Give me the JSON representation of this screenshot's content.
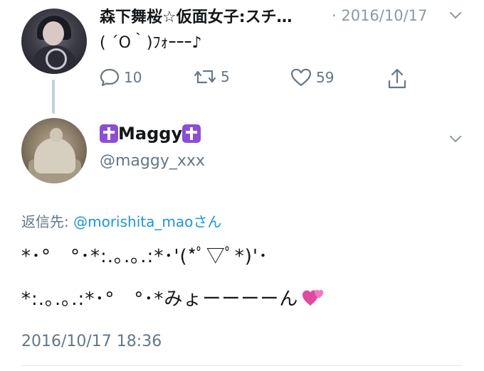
{
  "parent_tweet": {
    "name": "森下舞桜☆仮面女子:スチ…",
    "date": "· 2016/10/17",
    "text": "( ´O｀)ﾌｫｰｰｰ♪",
    "actions": {
      "replies": "10",
      "retweets": "5",
      "likes": "59"
    }
  },
  "reply_tweet": {
    "display_name": "Maggy",
    "handle": "@maggy_xxx",
    "reply_prefix": "返信先: ",
    "reply_to": "@morishita_maoさん",
    "line1": "*･°　°･*:.｡.｡.:*･'(*ﾟ▽ﾟ*)'･",
    "line2": "*:.｡.｡.:*･°　°･*みょーーーーん",
    "timestamp": "2016/10/17 18:36"
  },
  "colors": {
    "text": "#14171a",
    "secondary": "#657786",
    "link": "#1b95e0",
    "cross_badge": "#8a4fd3",
    "thread_line": "#c4cfd6"
  }
}
